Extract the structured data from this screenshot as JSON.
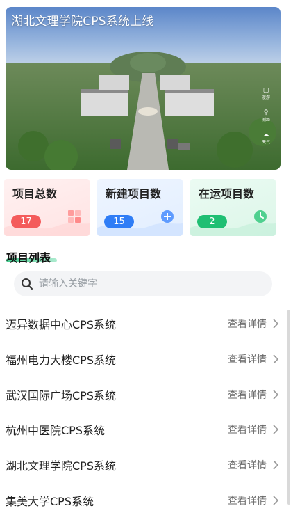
{
  "hero": {
    "title": "湖北文理学院CPS系统上线",
    "tools": [
      "漫游",
      "测距",
      "天气"
    ]
  },
  "stats": [
    {
      "label": "项目总数",
      "value": "17",
      "color": "#f45b5b"
    },
    {
      "label": "新建项目数",
      "value": "15",
      "color": "#2f7df6"
    },
    {
      "label": "在运项目数",
      "value": "2",
      "color": "#1fbf73"
    }
  ],
  "section": {
    "title": "项目列表"
  },
  "search": {
    "placeholder": "请输入关键字"
  },
  "projects": [
    {
      "name": "迈异数据中心CPS系统",
      "action": "查看详情"
    },
    {
      "name": "福州电力大楼CPS系统",
      "action": "查看详情"
    },
    {
      "name": "武汉国际广场CPS系统",
      "action": "查看详情"
    },
    {
      "name": "杭州中医院CPS系统",
      "action": "查看详情"
    },
    {
      "name": "湖北文理学院CPS系统",
      "action": "查看详情"
    },
    {
      "name": "集美大学CPS系统",
      "action": "查看详情"
    }
  ]
}
